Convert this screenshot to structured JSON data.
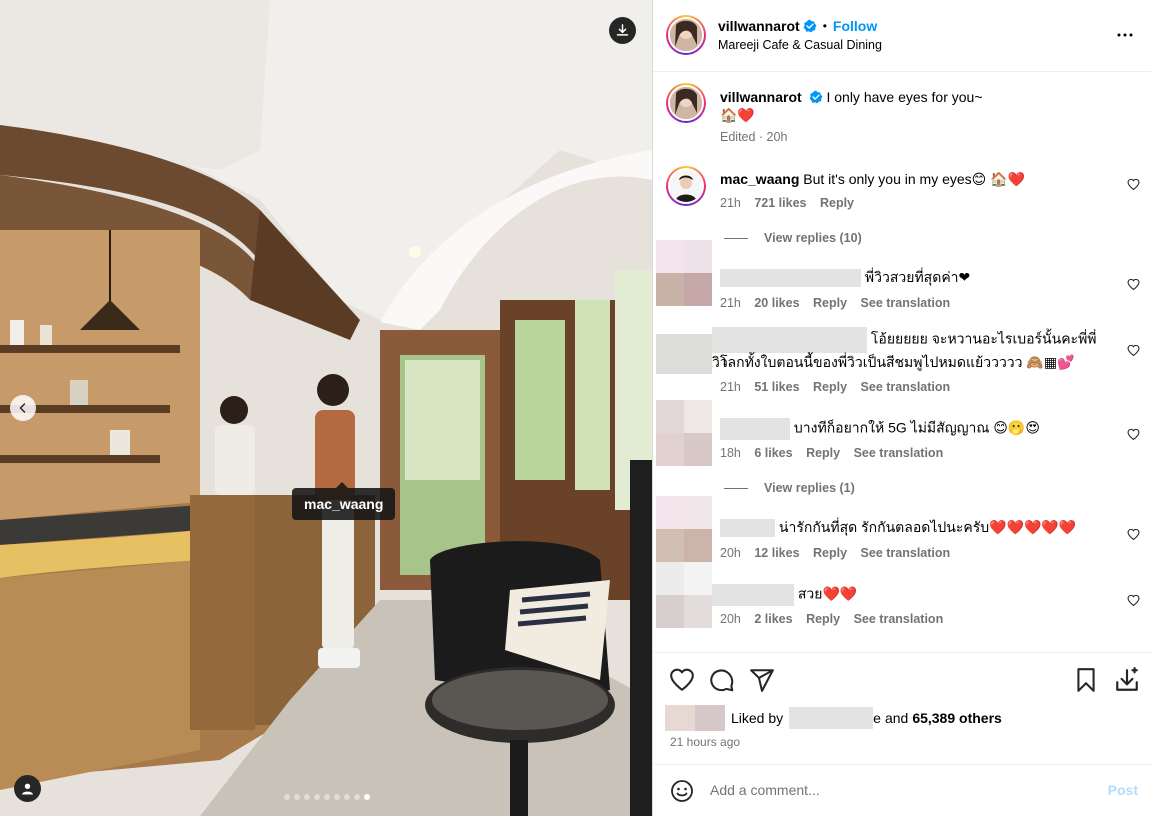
{
  "post": {
    "author": "villwannarot",
    "follow_label": "Follow",
    "separator": "•",
    "location": "Mareeji Cafe & Casual Dining",
    "caption": "I only have eyes for you~",
    "caption_emoji": "🏠❤️",
    "caption_meta": "Edited · 20h",
    "photo_tag": "mac_waang",
    "carousel": {
      "count": 9,
      "active_index": 8
    }
  },
  "comments": [
    {
      "user": "mac_waang",
      "text": "But it's only you in my eyes😊 🏠❤️",
      "time": "21h",
      "likes": "721 likes",
      "reply": "Reply",
      "view_replies": "View replies (10)"
    },
    {
      "user": "",
      "text": "พี่วิวสวยที่สุดค่า❤",
      "time": "21h",
      "likes": "20 likes",
      "reply": "Reply",
      "translate": "See translation"
    },
    {
      "user": "",
      "text_line1": "โอ้ยยยยย จะหวานอะไรเบอร์นั้นคะพี่พี่วิว",
      "text_line2": "โลกทั้งใบตอนนี้ของพี่วิวเป็นสีชมพูไปหมดแย้ววววว 🙈▦💕",
      "time": "21h",
      "likes": "51 likes",
      "reply": "Reply",
      "translate": "See translation"
    },
    {
      "user": "",
      "text": "บางทีก็อยากให้ 5G ไม่มีสัญญาณ 😊🫢😍",
      "time": "18h",
      "likes": "6 likes",
      "reply": "Reply",
      "translate": "See translation",
      "view_replies": "View replies (1)"
    },
    {
      "user": "",
      "text": "น่ารักกันที่สุด รักกันตลอดไปนะครับ❤️❤️❤️❤️❤️",
      "time": "20h",
      "likes": "12 likes",
      "reply": "Reply",
      "translate": "See translation"
    },
    {
      "user": "",
      "text": "สวย❤️❤️",
      "time": "20h",
      "likes": "2 likes",
      "reply": "Reply",
      "translate": "See translation"
    }
  ],
  "likes": {
    "liked_by_label": "Liked by",
    "partial_name": "e",
    "and_label": "and",
    "others": "65,389 others"
  },
  "time_ago": "21 hours ago",
  "comment_box": {
    "placeholder": "Add a comment...",
    "post_label": "Post"
  },
  "colors": {
    "accent": "#0095f6",
    "secondary_text": "#737373",
    "post_disabled": "#b3dbff"
  },
  "icons": [
    "download-icon",
    "chevron-left-icon",
    "user-tag-icon",
    "verified-icon",
    "more-icon",
    "heart-icon",
    "comment-icon",
    "share-icon",
    "bookmark-icon",
    "save-download-icon",
    "emoji-icon"
  ]
}
